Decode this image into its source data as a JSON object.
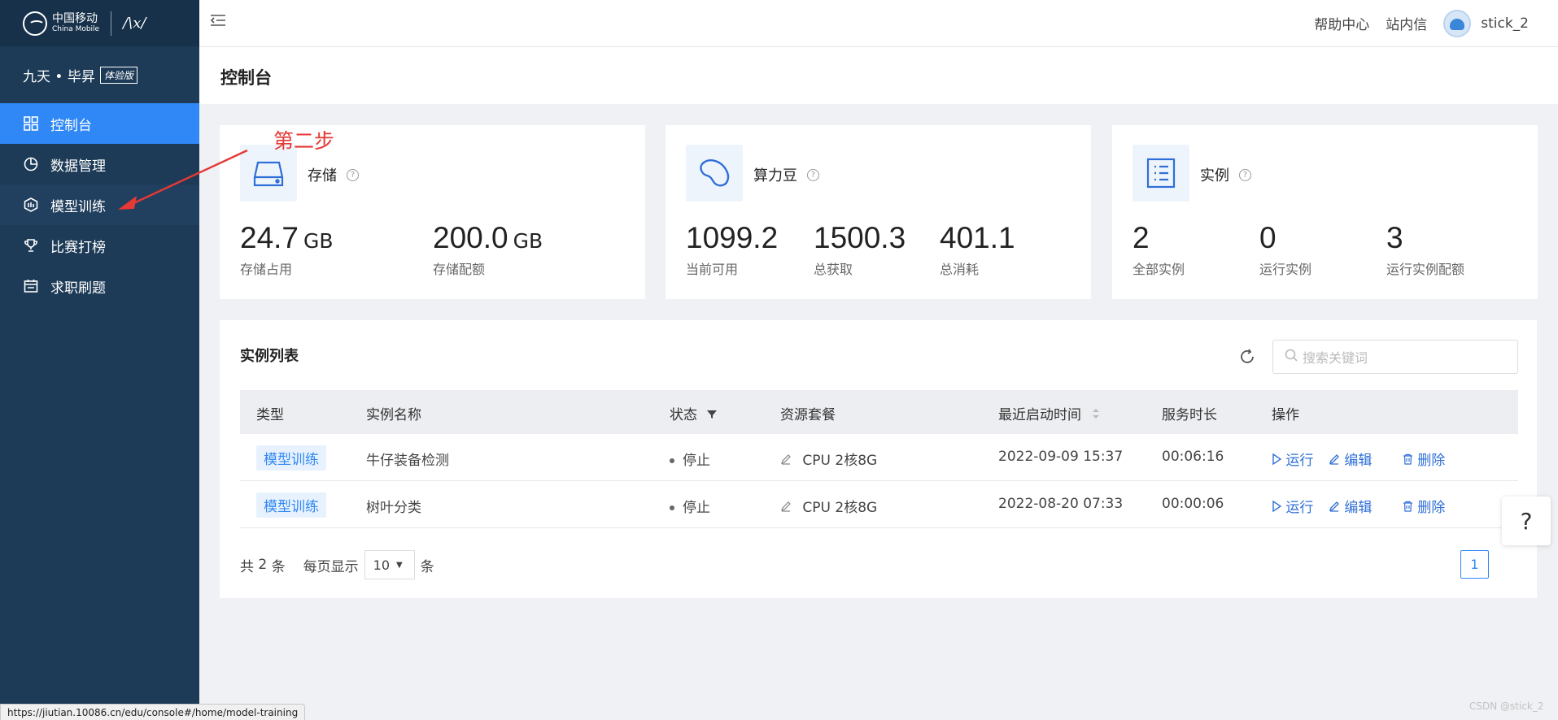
{
  "sidebar": {
    "logo_cn": "中国移动",
    "logo_en": "China Mobile",
    "logo_script": "/\\x/",
    "brand_name": "九天 • 毕昇",
    "brand_badge": "体验版",
    "items": [
      {
        "label": "控制台",
        "icon": "grid-icon",
        "active": true
      },
      {
        "label": "数据管理",
        "icon": "pie-chart-icon"
      },
      {
        "label": "模型训练",
        "icon": "model-icon"
      },
      {
        "label": "比赛打榜",
        "icon": "trophy-icon"
      },
      {
        "label": "求职刷题",
        "icon": "calendar-icon"
      }
    ]
  },
  "header": {
    "help_center": "帮助中心",
    "inbox": "站内信",
    "username": "stick_2"
  },
  "page": {
    "title": "控制台"
  },
  "cards": {
    "storage": {
      "title": "存储",
      "used": "24.7",
      "used_unit": "GB",
      "used_label": "存储占用",
      "quota": "200.0",
      "quota_unit": "GB",
      "quota_label": "存储配额"
    },
    "beans": {
      "title": "算力豆",
      "available": "1099.2",
      "available_label": "当前可用",
      "total": "1500.3",
      "total_label": "总获取",
      "consumed": "401.1",
      "consumed_label": "总消耗"
    },
    "instances": {
      "title": "实例",
      "all": "2",
      "all_label": "全部实例",
      "running": "0",
      "running_label": "运行实例",
      "quota": "3",
      "quota_label": "运行实例配额"
    }
  },
  "instance_list": {
    "title": "实例列表",
    "search_placeholder": "搜索关键词",
    "columns": [
      "类型",
      "实例名称",
      "状态",
      "资源套餐",
      "最近启动时间",
      "服务时长",
      "操作"
    ],
    "rows": [
      {
        "type": "模型训练",
        "name": "牛仔装备检测",
        "status": "停止",
        "resource": "CPU 2核8G",
        "start_time": "2022-09-09 15:37",
        "duration": "00:06:16"
      },
      {
        "type": "模型训练",
        "name": "树叶分类",
        "status": "停止",
        "resource": "CPU 2核8G",
        "start_time": "2022-08-20 07:33",
        "duration": "00:00:06"
      }
    ],
    "actions": {
      "run": "运行",
      "edit": "编辑",
      "delete": "删除"
    },
    "pager": {
      "total_prefix": "共",
      "total": "2",
      "total_suffix": "条",
      "per_page_label": "每页显示",
      "per_page": "10",
      "per_page_suffix": "条",
      "current_page": "1"
    }
  },
  "annotation": {
    "text": "第二步",
    "color": "#e53935"
  },
  "help_fab": "?",
  "status_url": "https://jiutian.10086.cn/edu/console#/home/model-training",
  "watermark": "CSDN @stick_2",
  "colors": {
    "sidebar": "#1d3b57",
    "accent": "#2f88f5",
    "annotation": "#e53935"
  }
}
